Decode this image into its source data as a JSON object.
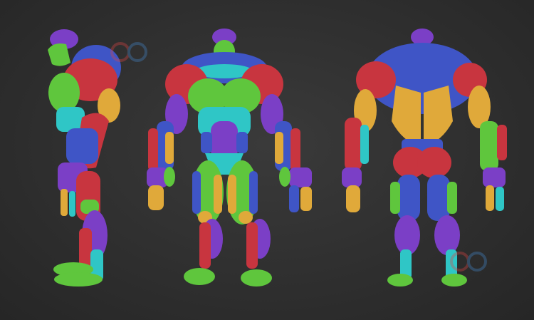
{
  "scene": {
    "background": "#2f2f2f",
    "views": [
      "side",
      "front",
      "back"
    ],
    "palette": {
      "red": "#c8353f",
      "blue": "#3f55c6",
      "purple": "#7b3fc6",
      "green": "#5fc63d",
      "yellow": "#e0a93a",
      "cyan": "#2fc6c6"
    }
  },
  "watermark": {
    "logo_icon": "circle-logo-icon",
    "text_top": "",
    "text_bottom": ""
  }
}
